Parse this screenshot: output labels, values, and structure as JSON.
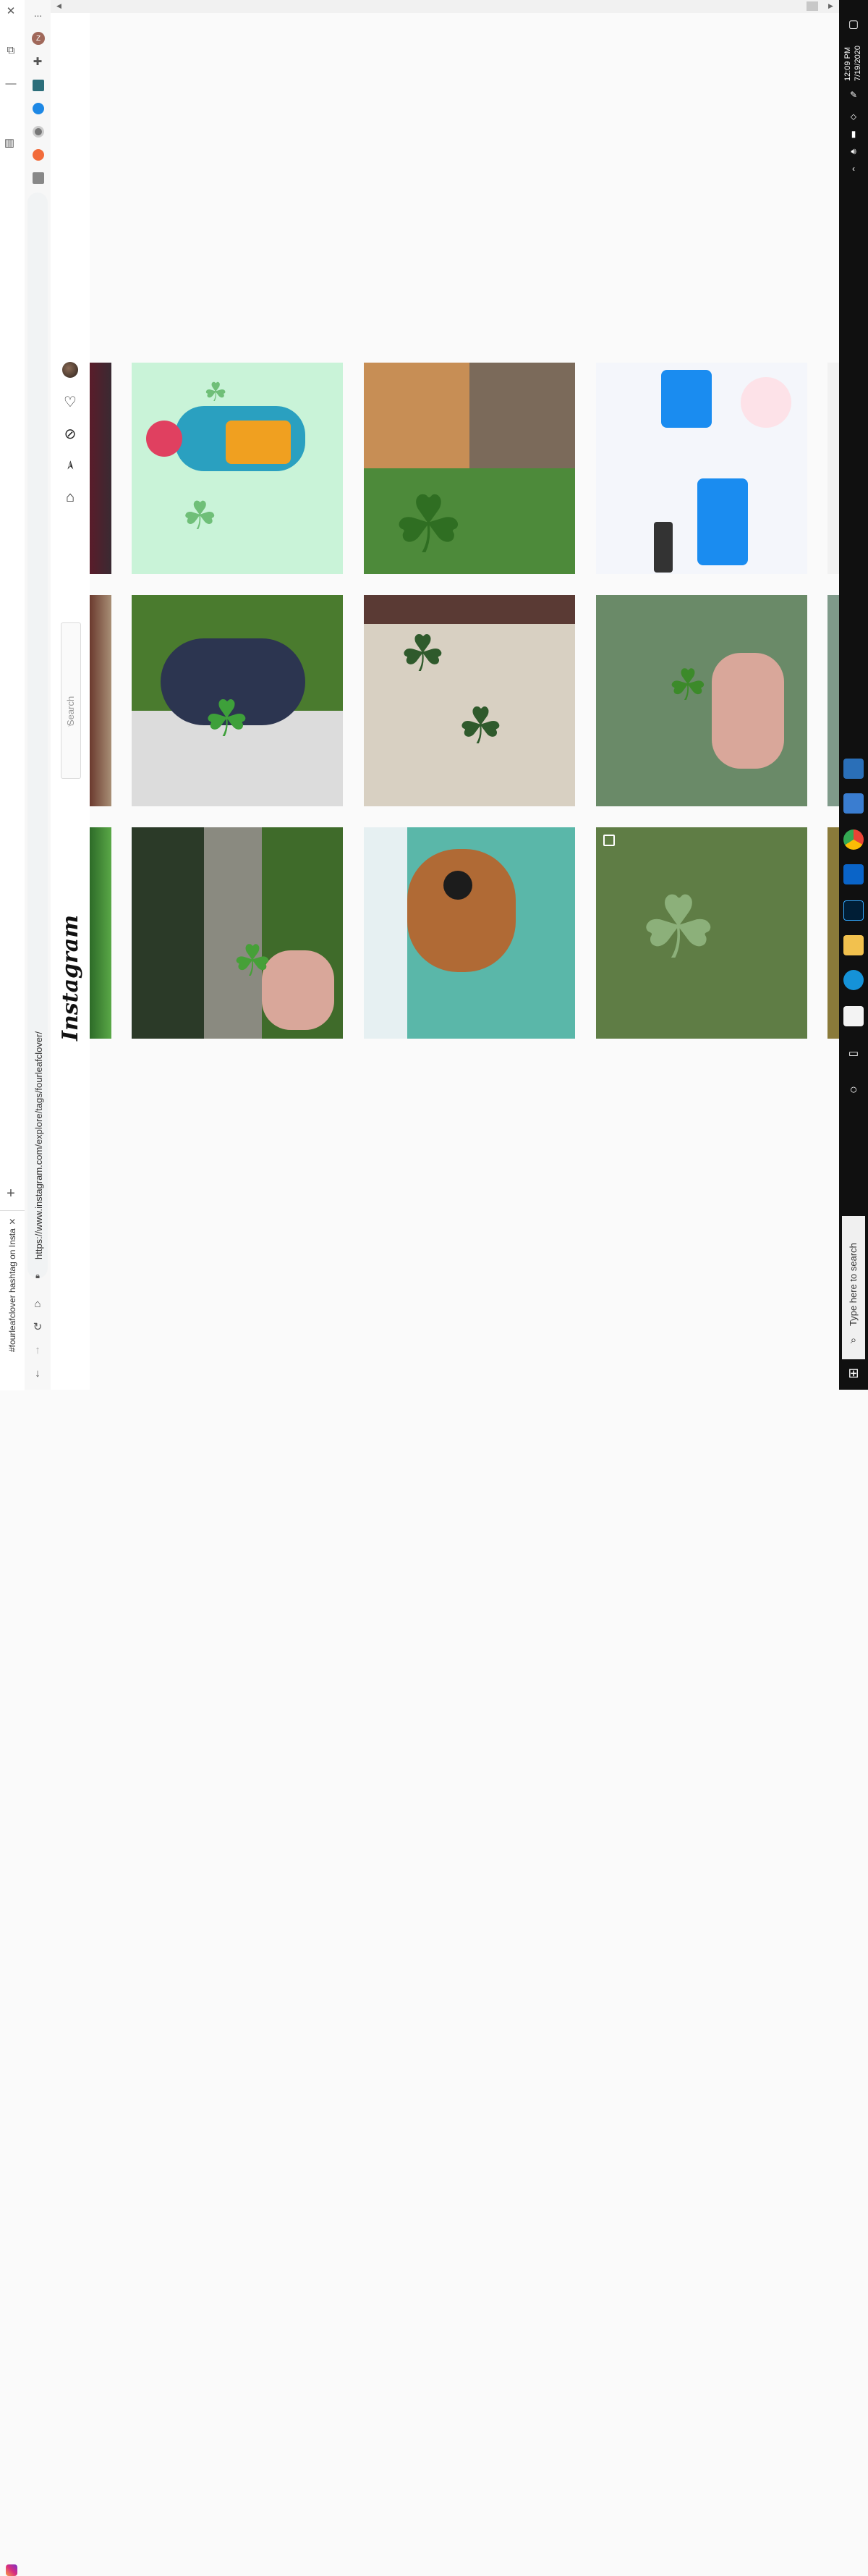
{
  "browser": {
    "tab_title": "#fourleafclover hashtag on Insta",
    "url": "https://www.instagram.com/explore/tags/fourleafclover/",
    "new_tab_symbol": "+",
    "close_symbol": "✕",
    "menu_symbol": "···",
    "profile_initial": "Z"
  },
  "instagram": {
    "logo": "Instagram",
    "search_placeholder": "Search"
  },
  "taskbar": {
    "time": "12:09 PM",
    "date": "7/19/2020",
    "search_placeholder": "Type here to search"
  },
  "grid": {
    "rows": [
      [
        {
          "name": "post-cartoon-clover",
          "bg": "#c9f3d8"
        },
        {
          "name": "post-cats-clover",
          "bg": "#4d8a3a"
        },
        {
          "name": "post-chat-screenshot",
          "bg": "#f4f6fb"
        }
      ],
      [
        {
          "name": "post-dog-clover",
          "bg": "#4a7b2e"
        },
        {
          "name": "post-pressed-clover",
          "bg": "#d8d0c2"
        },
        {
          "name": "post-hand-clover",
          "bg": "#6a8a68"
        }
      ],
      [
        {
          "name": "post-field-clover",
          "bg": "#3f6b2a"
        },
        {
          "name": "post-dog-teal",
          "bg": "#5ab7a9"
        },
        {
          "name": "post-grass-clover",
          "bg": "#5f7d45"
        }
      ]
    ]
  }
}
